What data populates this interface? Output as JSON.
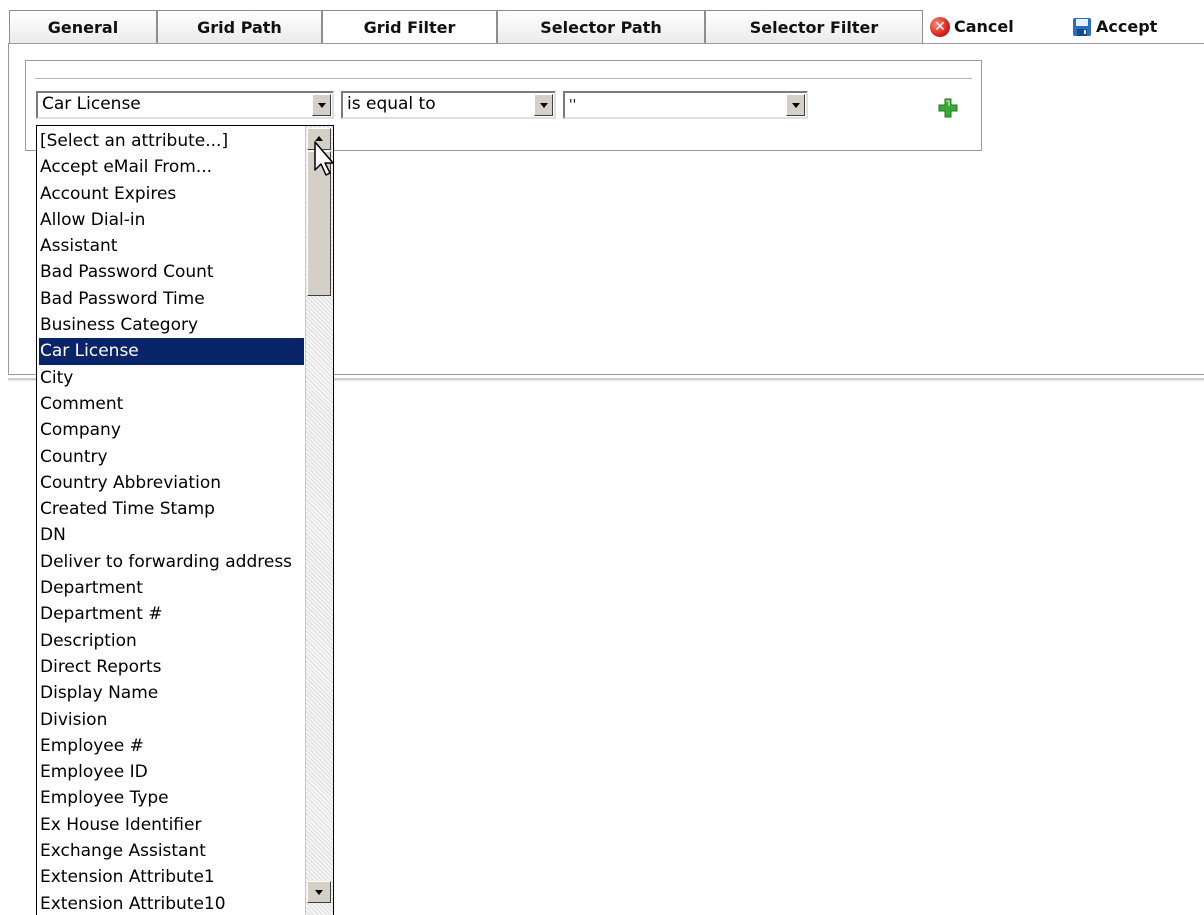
{
  "tabs": [
    {
      "label": "General"
    },
    {
      "label": "Grid Path"
    },
    {
      "label": "Grid Filter"
    },
    {
      "label": "Selector Path"
    },
    {
      "label": "Selector Filter"
    }
  ],
  "active_tab": "Grid Filter",
  "actions": {
    "cancel_label": "Cancel",
    "accept_label": "Accept",
    "cancel_icon": "cancel-icon",
    "accept_icon": "save-icon"
  },
  "filter": {
    "attribute_value": "Car License",
    "operator_value": "is equal to",
    "value_value": "''",
    "add_icon": "add-icon"
  },
  "attribute_options": [
    "[Select an attribute...]",
    "Accept eMail From...",
    "Account Expires",
    "Allow Dial-in",
    "Assistant",
    "Bad Password Count",
    "Bad Password Time",
    "Business Category",
    "Car License",
    "City",
    "Comment",
    "Company",
    "Country",
    "Country Abbreviation",
    "Created Time Stamp",
    "DN",
    "Deliver to forwarding address",
    "Department",
    "Department #",
    "Description",
    "Direct Reports",
    "Display Name",
    "Division",
    "Employee #",
    "Employee ID",
    "Employee Type",
    "Ex House Identifier",
    "Exchange Assistant",
    "Extension Attribute1",
    "Extension Attribute10"
  ],
  "selected_option": "Car License",
  "colors": {
    "selection": "#0a246a",
    "add_icon": "#3aa83a",
    "cancel_icon": "#d8231b",
    "save_icon": "#2b6cc4"
  }
}
